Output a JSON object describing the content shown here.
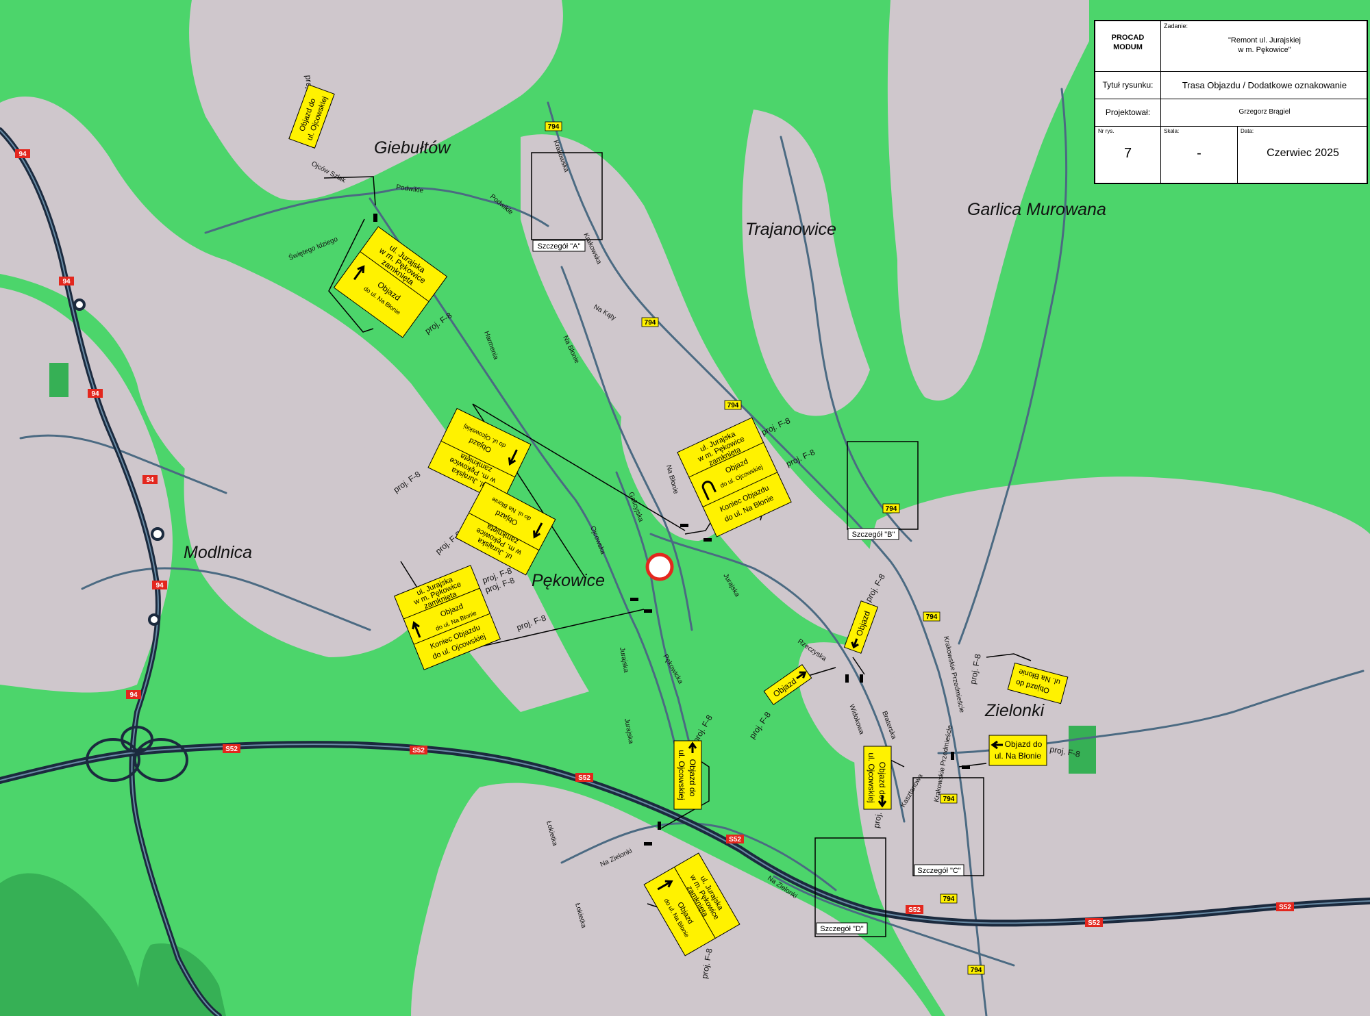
{
  "colors": {
    "forest": "#4CD56B",
    "built_area": "#CFC7CC",
    "road": "#4B6A82",
    "expressway": "#1B2A3E",
    "sign": "#FFF200",
    "route_label": "#FFF200",
    "expressway_label": "#E3271E"
  },
  "title_block": {
    "company_line1": "PROCAD",
    "company_line2": "MODUM",
    "task_label": "Zadanie:",
    "task_line1": "\"Remont ul. Jurajskiej",
    "task_line2": "w m. Pękowice\"",
    "drawing_title_label": "Tytuł rysunku:",
    "drawing_title": "Trasa Objazdu / Dodatkowe oznakowanie",
    "designer_label": "Projektował:",
    "designer": "Grzegorz Brągiel",
    "drawing_no_label": "Nr rys.",
    "drawing_no": "7",
    "scale_label": "Skala:",
    "scale": "-",
    "date_label": "Data:",
    "date": "Czerwiec 2025"
  },
  "places": {
    "giebultow": "Giebułtów",
    "trajanowice": "Trajanowice",
    "garlica": "Garlica Murowana",
    "modlnica": "Modlnica",
    "pekowice": "Pękowice",
    "zielonki": "Zielonki"
  },
  "details": {
    "a": "Szczegół \"A\"",
    "b": "Szczegół \"B\"",
    "c": "Szczegół \"C\"",
    "d": "Szczegół \"D\""
  },
  "roads": {
    "r94": "94",
    "r794": "794",
    "s52": "S52"
  },
  "street_names": {
    "podwikle": "Podwikle",
    "swietego_idziego": "Świętego Idziego",
    "ojcow_szlak": "Ojców Szlak",
    "krakowska": "Krakowska",
    "na_katy": "Na Kąty",
    "na_blonie": "Na Błonie",
    "harmenia": "Harmenia",
    "galicyjska": "Galicyjska",
    "ojcowska": "Ojcowska",
    "jurajska": "Jurajska",
    "pekowicka": "Pękowicka",
    "na_zielonki": "Na Zielonki",
    "lokietka": "Łokietka",
    "rzeczyska": "Rzeczyska",
    "widokowa": "Widokowa",
    "braterska": "Braterska",
    "kasztanowa": "Kasztanowa",
    "krakowskie_przedmiescie": "Krakowskie Przedmieście"
  },
  "labels": {
    "proj_f8": "proj. F-8"
  },
  "signs": {
    "s1": [
      "ul. Jurajska",
      "w m. Pękowice",
      "zamknięta",
      "Objazd",
      "do ul. Na Błonie"
    ],
    "s2": [
      "Objazd do",
      "ul. Ojcowskiej"
    ],
    "s3": [
      "ul. Jurajska",
      "w m. Pękowice",
      "zamknięta",
      "Objazd",
      "do ul. Ojcowskiej"
    ],
    "s4": [
      "ul. Jurajska",
      "w m. Pękowice",
      "zamknięta",
      "Objazd",
      "do ul. Na Błonie"
    ],
    "s5": [
      "ul. Jurajska",
      "w m. Pękowice",
      "zamknięta",
      "Objazd",
      "do ul. Ojcowskiej",
      "Koniec Objazdu",
      "do ul. Na Błonie"
    ],
    "s6": [
      "ul. Jurajska",
      "w m. Pękowice",
      "zamknięta",
      "Objazd",
      "do ul. Na Błonie",
      "Koniec Objazdu",
      "do ul. Ojcowskiej"
    ],
    "s7": [
      "Objazd"
    ],
    "s8": [
      "Objazd"
    ],
    "s9": [
      "Objazd do",
      "ul. Na Błonie"
    ],
    "s10": [
      "Objazd do",
      "ul. Na Błonie"
    ],
    "s11": [
      "Objazd do",
      "ul. Ojcowskiej"
    ],
    "s12": [
      "Objazd do",
      "ul. Ojcowskiej"
    ],
    "s13": [
      "ul. Jurajska",
      "w m. Pękowice",
      "zamknięta",
      "Objazd",
      "do ul. Na Błonie"
    ]
  }
}
